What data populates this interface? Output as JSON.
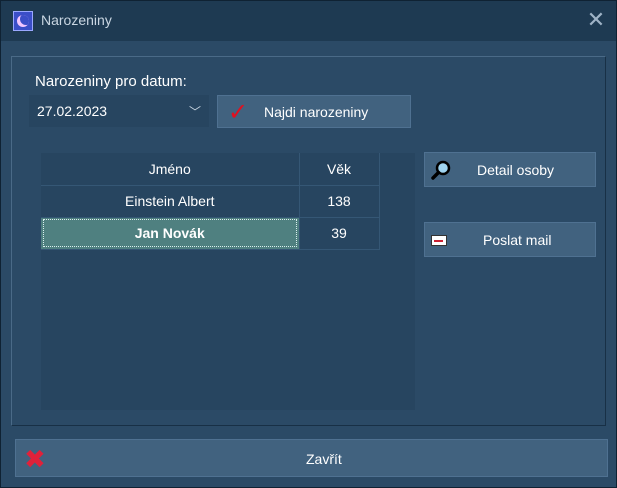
{
  "window": {
    "title": "Narozeniny"
  },
  "search": {
    "label": "Narozeniny pro datum:",
    "date_value": "27.02.2023",
    "find_button": "Najdi narozeniny"
  },
  "table": {
    "columns": [
      "Jméno",
      "Věk"
    ],
    "rows": [
      {
        "name": "Einstein Albert",
        "age": "138"
      },
      {
        "name": "Jan Novák",
        "age": "39"
      }
    ],
    "selected_row": 1
  },
  "actions": {
    "detail_button": "Detail osoby",
    "mail_button": "Poslat mail",
    "close_button": "Zavřít"
  },
  "colors": {
    "background": "#2b4a66",
    "titlebar": "#1e3a52",
    "button": "#41627f",
    "selection": "#4f8080",
    "close_icon": "#e0213a",
    "check_icon": "#e01020"
  }
}
